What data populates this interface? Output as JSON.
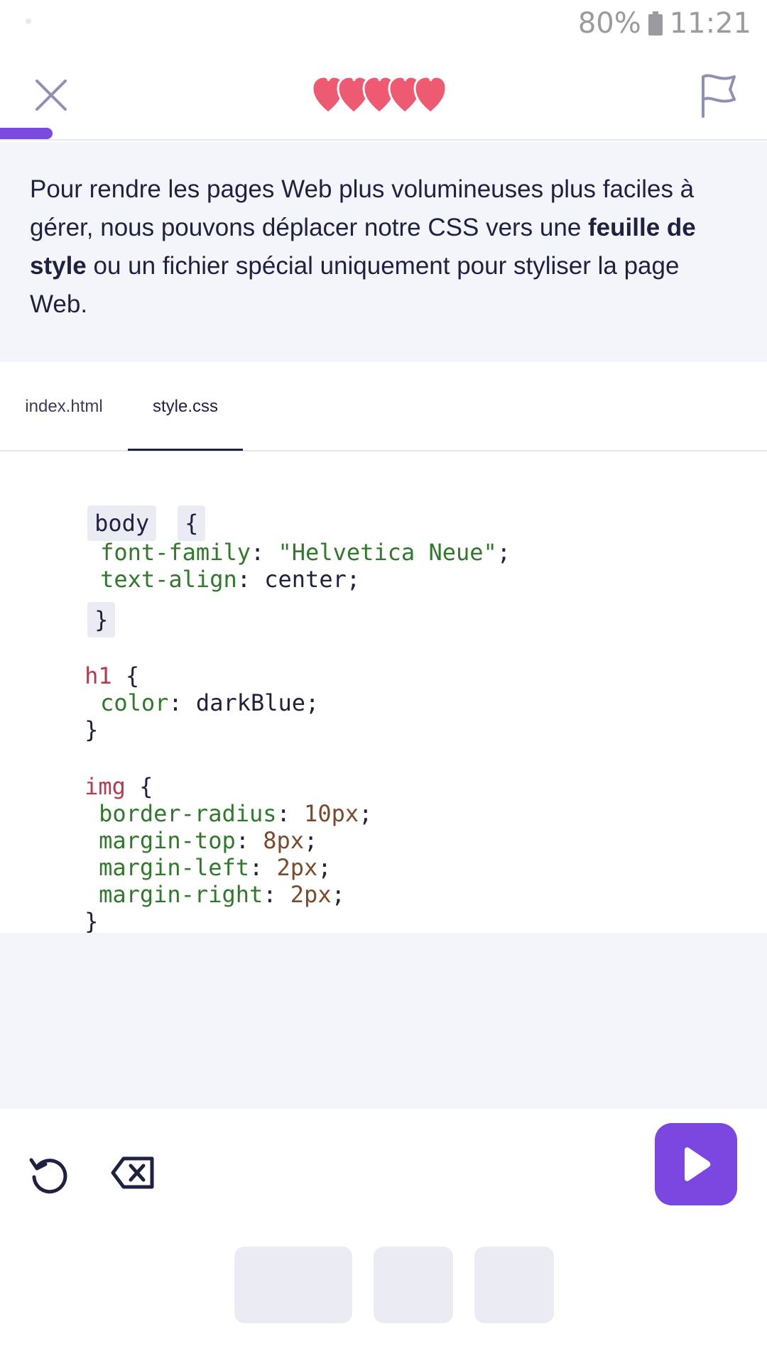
{
  "status": {
    "battery": "80%",
    "time": "11:21"
  },
  "topbar": {
    "hearts_count": 5,
    "progress_fraction": 0.07,
    "colors": {
      "accent": "#7b4ae0",
      "heart": "#ef5a73"
    }
  },
  "instruction": {
    "part1": "Pour rendre les pages Web plus volumineuses plus faciles à gérer, nous pouvons déplacer notre CSS vers une ",
    "bold": "feuille de style",
    "part2": " ou un fichier spécial uniquement pour styliser la page Web."
  },
  "tabs": [
    {
      "label": "index.html",
      "active": false
    },
    {
      "label": "style.css",
      "active": true
    }
  ],
  "code": {
    "body_selector": "body",
    "open_brace": "{",
    "close_brace": "}",
    "body_decls": [
      {
        "prop": "font-family",
        "value": "\"Helvetica Neue\""
      },
      {
        "prop": "text-align",
        "value": "center"
      }
    ],
    "h1_selector": "h1",
    "h1_decls": [
      {
        "prop": "color",
        "value": "darkBlue"
      }
    ],
    "img_selector": "img",
    "img_decls": [
      {
        "prop": "border-radius",
        "value": "10px"
      },
      {
        "prop": "margin-top",
        "value": "8px"
      },
      {
        "prop": "margin-left",
        "value": "2px"
      },
      {
        "prop": "margin-right",
        "value": "2px"
      }
    ]
  },
  "toolbar": {
    "icons": [
      "reset-icon",
      "backspace-icon",
      "play-icon"
    ],
    "option_chip_count": 3
  }
}
